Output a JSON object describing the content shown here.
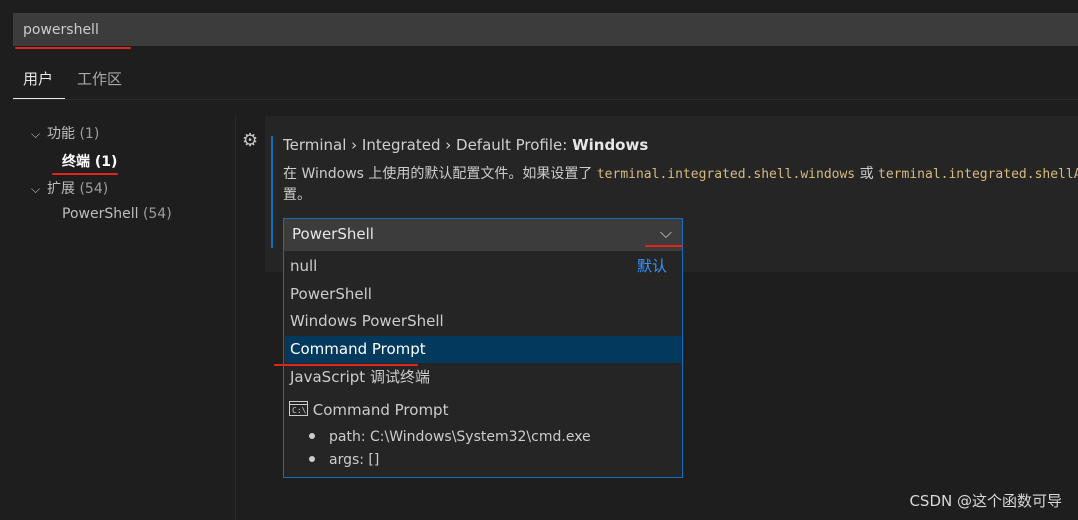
{
  "search": {
    "value": "powershell"
  },
  "tabs": [
    {
      "label": "用户"
    },
    {
      "label": "工作区"
    }
  ],
  "toc": [
    {
      "label": "功能",
      "count": "(1)",
      "chevron": "chevron-down"
    },
    {
      "label": "终端",
      "count": "(1)"
    },
    {
      "label": "扩展",
      "count": "(54)",
      "chevron": "chevron-down"
    },
    {
      "label": "PowerShell",
      "count": "(54)"
    }
  ],
  "setting": {
    "breadcrumb": "Terminal › Integrated › Default Profile:",
    "name": "Windows",
    "description": {
      "part1": "在 Windows 上使用的默认配置文件。如果设置了 ",
      "code1": "terminal.integrated.shell.windows",
      "part2": " 或 ",
      "code2": "terminal.integrated.shellArgs.windows",
      "line2": "置。"
    },
    "selected_value": "PowerShell",
    "options": [
      {
        "label": "null",
        "badge": "默认"
      },
      {
        "label": "PowerShell"
      },
      {
        "label": "Windows PowerShell"
      },
      {
        "label": "Command Prompt"
      },
      {
        "label": "JavaScript 调试终端"
      }
    ],
    "detail": {
      "title": "Command Prompt",
      "icon": "terminal-icon",
      "icon_text": "C:\\",
      "path": "path: C:\\Windows\\System32\\cmd.exe",
      "args": "args: []"
    }
  },
  "watermark": "CSDN @这个函数可导",
  "colors": {
    "accent": "#0e6fc1",
    "highlight": "#04395e",
    "annotation": "#e0261b"
  }
}
